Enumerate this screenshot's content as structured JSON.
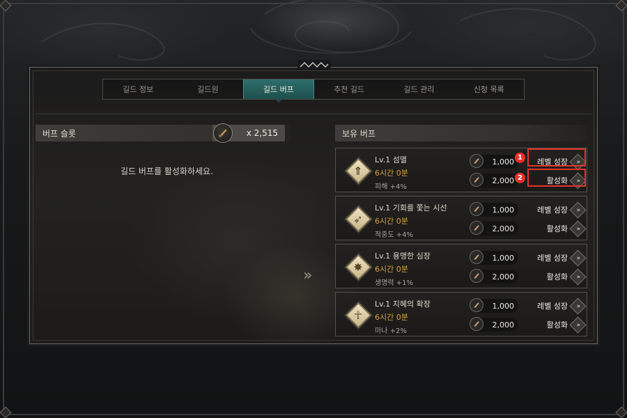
{
  "tabs": [
    {
      "label": "길드 정보",
      "active": false
    },
    {
      "label": "길드원",
      "active": false
    },
    {
      "label": "길드 버프",
      "active": true
    },
    {
      "label": "추천 길드",
      "active": false
    },
    {
      "label": "길드 관리",
      "active": false
    },
    {
      "label": "신청 목록",
      "active": false
    }
  ],
  "slot": {
    "title": "버프 슬롯",
    "count": "x 2,515",
    "icon": "scroll-icon",
    "empty_message": "길드 버프를 활성화하세요."
  },
  "owned": {
    "title": "보유 버프",
    "buffs": [
      {
        "name": "Lv.1 섬멸",
        "duration": "6시간 0분",
        "effect_label": "피해",
        "effect_value": "+4%",
        "icon": "arrow-up-icon",
        "upgrade_cost": "1,000",
        "activate_cost": "2,000",
        "upgrade_label": "레벨 성장",
        "activate_label": "활성화"
      },
      {
        "name": "Lv.1 기회를 쫓는 시선",
        "duration": "6시간 0분",
        "effect_label": "적중도",
        "effect_value": "+4%",
        "icon": "bow-icon",
        "upgrade_cost": "1,000",
        "activate_cost": "2,000",
        "upgrade_label": "레벨 성장",
        "activate_label": "활성화"
      },
      {
        "name": "Lv.1 용맹한 심장",
        "duration": "6시간 0분",
        "effect_label": "생명력",
        "effect_value": "+1%",
        "icon": "star-burst-icon",
        "upgrade_cost": "1,000",
        "activate_cost": "2,000",
        "upgrade_label": "레벨 성장",
        "activate_label": "활성화"
      },
      {
        "name": "Lv.1 지혜의 확장",
        "duration": "6시간 0분",
        "effect_label": "마나",
        "effect_value": "+2%",
        "icon": "ankh-icon",
        "upgrade_cost": "1,000",
        "activate_cost": "2,000",
        "upgrade_label": "레벨 성장",
        "activate_label": "활성화"
      }
    ]
  },
  "annotations": [
    {
      "number": "1"
    },
    {
      "number": "2"
    }
  ],
  "colors": {
    "accent_tab": "#2e6e6c",
    "duration_gold": "#d8a23c",
    "highlight_red": "#e8322a"
  }
}
